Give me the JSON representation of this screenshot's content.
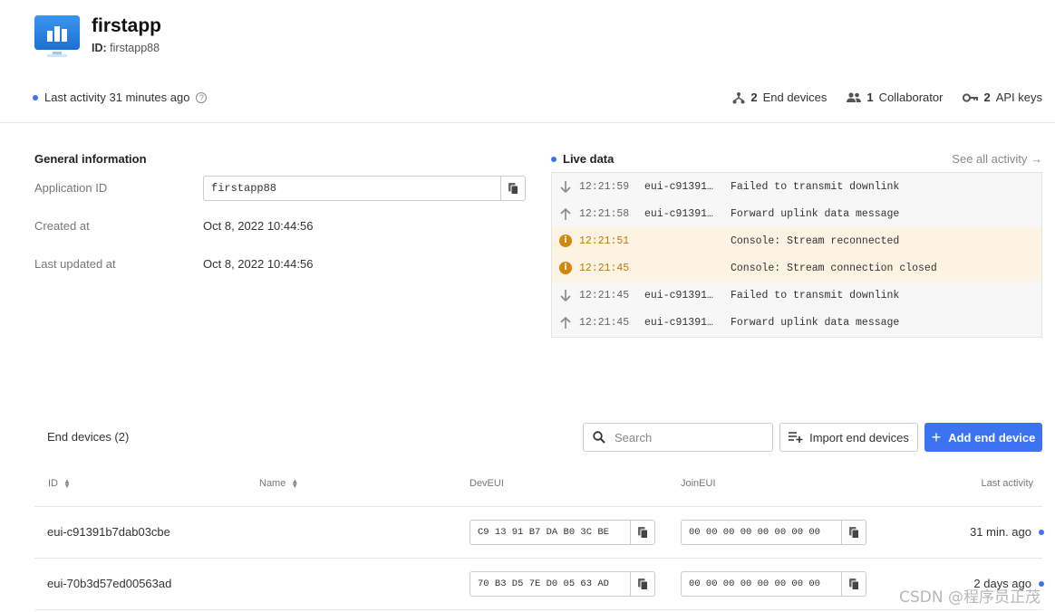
{
  "app": {
    "title": "firstapp",
    "id_label": "ID:",
    "id_value": "firstapp88"
  },
  "activity": {
    "text": "Last activity 31 minutes ago"
  },
  "stats": [
    {
      "count": "2",
      "label": "End devices",
      "icon": "fork-icon"
    },
    {
      "count": "1",
      "label": "Collaborator",
      "icon": "people-icon"
    },
    {
      "count": "2",
      "label": "API keys",
      "icon": "key-icon"
    }
  ],
  "general": {
    "title": "General information",
    "app_id_label": "Application ID",
    "app_id_value": "firstapp88",
    "created_label": "Created at",
    "created_value": "Oct 8, 2022 10:44:56",
    "updated_label": "Last updated at",
    "updated_value": "Oct 8, 2022 10:44:56"
  },
  "live": {
    "title": "Live data",
    "see_all": "See all activity →",
    "rows": [
      {
        "type": "down",
        "time": "12:21:59",
        "device": "eui-c91391…",
        "message": "Failed to transmit downlink"
      },
      {
        "type": "up",
        "time": "12:21:58",
        "device": "eui-c91391…",
        "message": "Forward uplink data message"
      },
      {
        "type": "warn",
        "time": "12:21:51",
        "device": "",
        "message": "Console: Stream reconnected"
      },
      {
        "type": "warn",
        "time": "12:21:45",
        "device": "",
        "message": "Console: Stream connection closed"
      },
      {
        "type": "down",
        "time": "12:21:45",
        "device": "eui-c91391…",
        "message": "Failed to transmit downlink"
      },
      {
        "type": "up",
        "time": "12:21:45",
        "device": "eui-c91391…",
        "message": "Forward uplink data message"
      }
    ]
  },
  "end_devices": {
    "title": "End devices (2)",
    "search_placeholder": "Search",
    "import_label": "Import end devices",
    "add_label": "Add end device",
    "columns": {
      "id": "ID",
      "name": "Name",
      "deveui": "DevEUI",
      "joineui": "JoinEUI",
      "last": "Last activity"
    },
    "rows": [
      {
        "id": "eui-c91391b7dab03cbe",
        "name": "",
        "deveui": "C9 13 91 B7 DA B0 3C BE",
        "joineui": "00 00 00 00 00 00 00 00",
        "last": "31 min. ago"
      },
      {
        "id": "eui-70b3d57ed00563ad",
        "name": "",
        "deveui": "70 B3 D5 7E D0 05 63 AD",
        "joineui": "00 00 00 00 00 00 00 00",
        "last": "2 days ago"
      }
    ]
  },
  "watermark": "CSDN @程序员正茂",
  "colors": {
    "accent": "#3b73f0",
    "warning": "#d4870e",
    "warning_bg": "#fdf3e3"
  }
}
